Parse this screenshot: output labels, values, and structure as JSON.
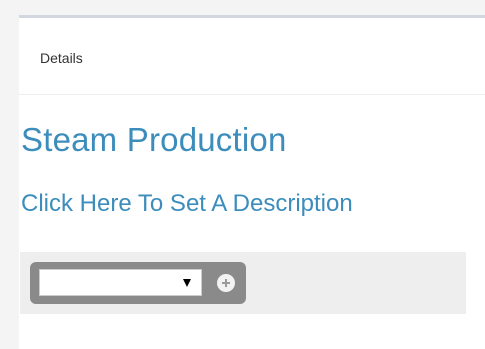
{
  "panel": {
    "header_title": "Details"
  },
  "entity": {
    "title": "Steam Production",
    "description_link": "Click Here To Set A Description"
  },
  "toolbar": {
    "select_value": "",
    "add_icon": "plus-circle-icon"
  },
  "colors": {
    "accent": "#3c8dbc",
    "panel_border": "#d2d6de",
    "toolbar_bg": "#eeeeee",
    "select_group_bg": "#8a8a8a"
  }
}
